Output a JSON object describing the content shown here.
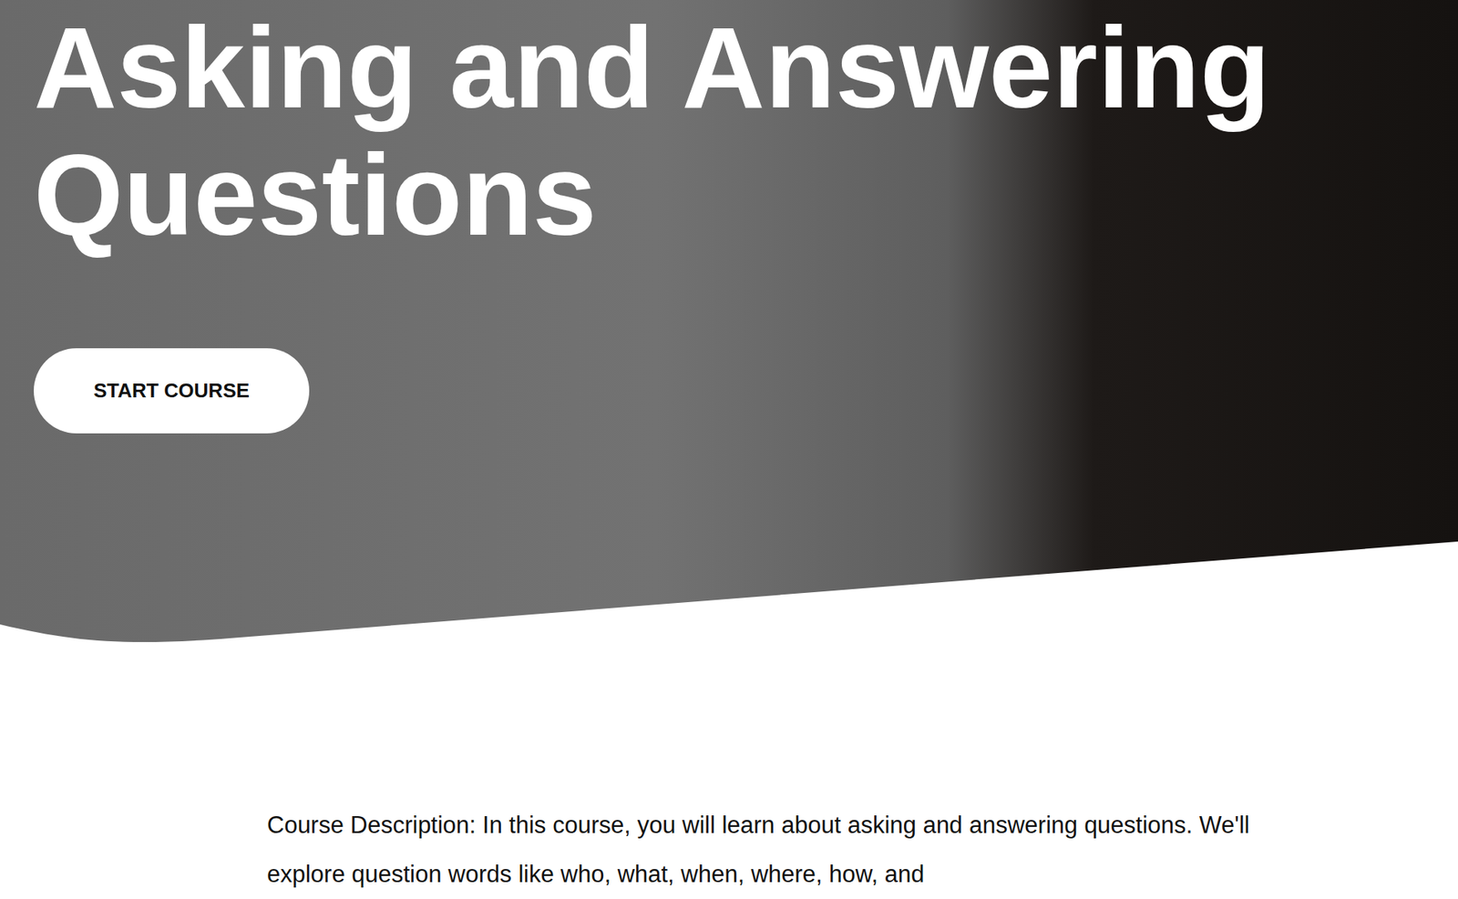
{
  "hero": {
    "title": "Asking and Answering Questions",
    "button": "START COURSE"
  },
  "description": "Course Description: In this course, you will learn about asking and answering questions. We'll explore question words like who, what, when, where, how, and"
}
